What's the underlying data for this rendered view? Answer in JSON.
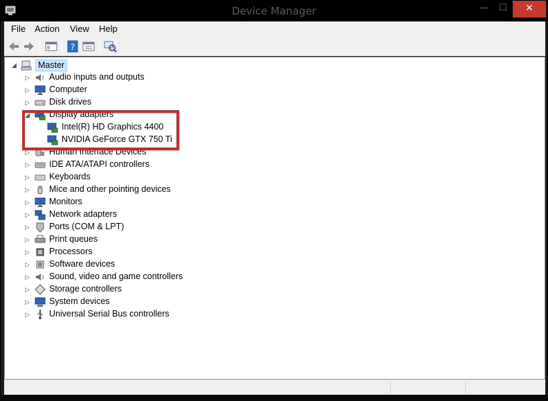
{
  "window": {
    "title": "Device Manager",
    "minimize_glyph": "—",
    "maximize_glyph": "☐",
    "close_glyph": "✕"
  },
  "menu": [
    {
      "label": "File"
    },
    {
      "label": "Action"
    },
    {
      "label": "View"
    },
    {
      "label": "Help"
    }
  ],
  "toolbar": {
    "buttons": [
      "back-arrow-icon",
      "forward-arrow-icon",
      "show-hide-console-tree-icon",
      "help-icon",
      "properties-icon",
      "scan-hardware-changes-icon"
    ]
  },
  "tree": {
    "root": {
      "label": "Master",
      "expanded": true,
      "selected": true,
      "icon": "computer-icon"
    },
    "categories": [
      {
        "label": "Audio inputs and outputs",
        "icon": "speaker-icon",
        "expanded": false
      },
      {
        "label": "Computer",
        "icon": "monitor-icon",
        "expanded": false
      },
      {
        "label": "Disk drives",
        "icon": "disk-drive-icon",
        "expanded": false
      },
      {
        "label": "Display adapters",
        "icon": "display-adapter-icon",
        "expanded": true,
        "children": [
          {
            "label": "Intel(R) HD Graphics 4400",
            "icon": "display-adapter-icon"
          },
          {
            "label": "NVIDIA GeForce GTX 750 Ti",
            "icon": "display-adapter-icon"
          }
        ]
      },
      {
        "label": "Human Interface Devices",
        "icon": "hid-icon",
        "expanded": false
      },
      {
        "label": "IDE ATA/ATAPI controllers",
        "icon": "ide-controller-icon",
        "expanded": false
      },
      {
        "label": "Keyboards",
        "icon": "keyboard-icon",
        "expanded": false
      },
      {
        "label": "Mice and other pointing devices",
        "icon": "mouse-icon",
        "expanded": false
      },
      {
        "label": "Monitors",
        "icon": "monitor-icon",
        "expanded": false
      },
      {
        "label": "Network adapters",
        "icon": "network-icon",
        "expanded": false
      },
      {
        "label": "Ports (COM & LPT)",
        "icon": "port-icon",
        "expanded": false
      },
      {
        "label": "Print queues",
        "icon": "printer-icon",
        "expanded": false
      },
      {
        "label": "Processors",
        "icon": "processor-icon",
        "expanded": false
      },
      {
        "label": "Software devices",
        "icon": "software-device-icon",
        "expanded": false
      },
      {
        "label": "Sound, video and game controllers",
        "icon": "speaker-icon",
        "expanded": false
      },
      {
        "label": "Storage controllers",
        "icon": "storage-controller-icon",
        "expanded": false
      },
      {
        "label": "System devices",
        "icon": "system-device-icon",
        "expanded": false
      },
      {
        "label": "Universal Serial Bus controllers",
        "icon": "usb-icon",
        "expanded": false
      }
    ]
  },
  "annotation": {
    "color": "#e11f26"
  },
  "colors": {
    "titlebar": "#000000",
    "close_button": "#c7392b",
    "selection": "#cce8ff"
  }
}
